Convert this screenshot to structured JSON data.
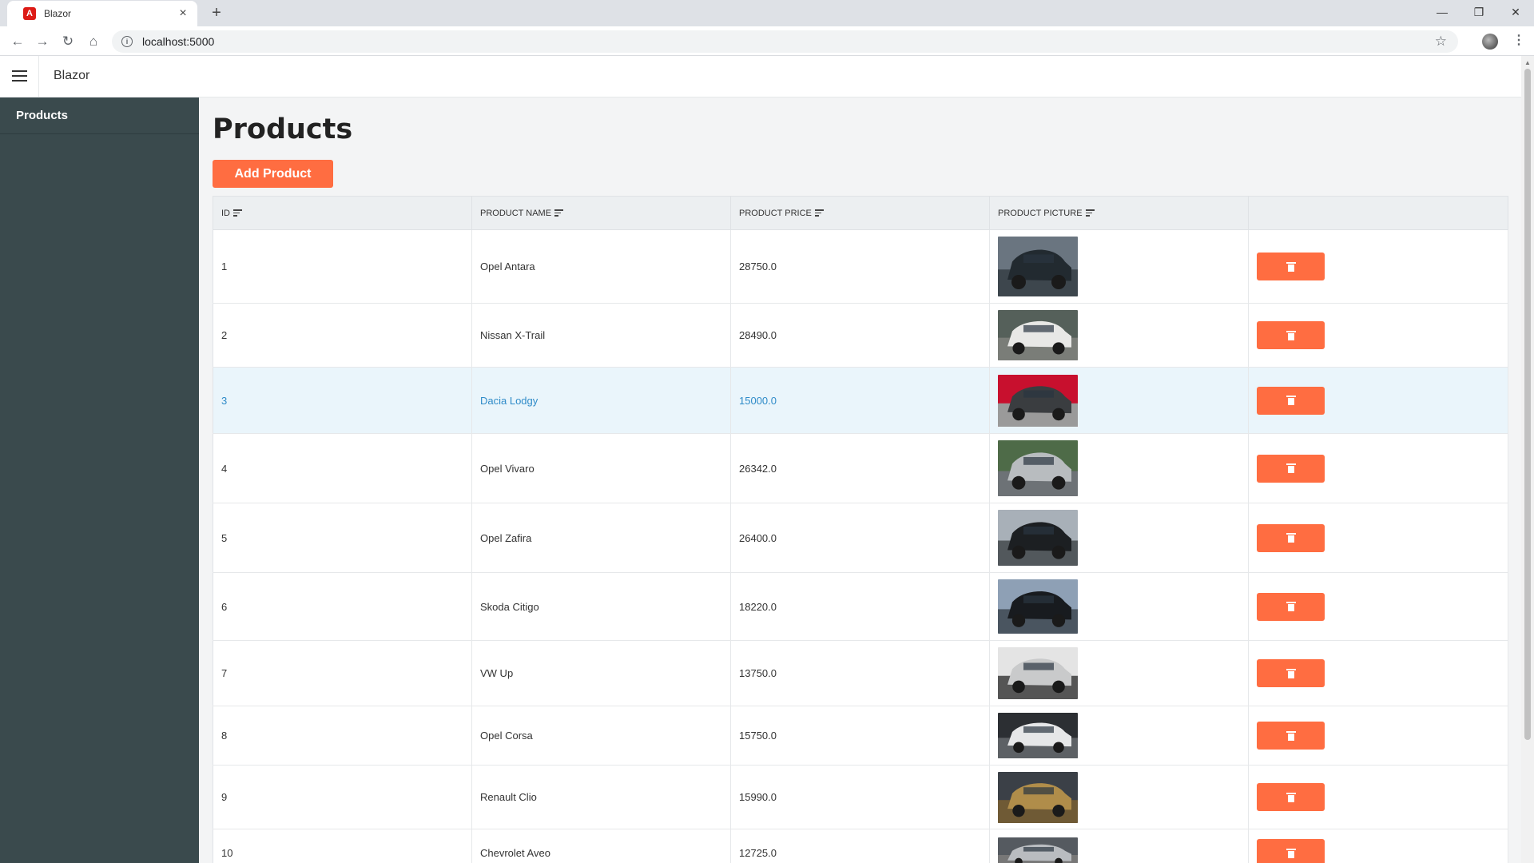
{
  "browser": {
    "tab_title": "Blazor",
    "tab_favicon": "A",
    "new_tab": "+",
    "url": "localhost:5000"
  },
  "app": {
    "title": "Blazor",
    "sidebar": {
      "items": [
        {
          "label": "Products"
        }
      ]
    }
  },
  "page": {
    "title": "Products",
    "add_label": "Add Product"
  },
  "grid": {
    "columns": [
      "ID",
      "PRODUCT NAME",
      "PRODUCT PRICE",
      "PRODUCT PICTURE"
    ],
    "rows": [
      {
        "id": "1",
        "name": "Opel Antara",
        "price": "28750.0",
        "img": "dark-suv",
        "selected": false
      },
      {
        "id": "2",
        "name": "Nissan X-Trail",
        "price": "28490.0",
        "img": "white-suv",
        "selected": false
      },
      {
        "id": "3",
        "name": "Dacia Lodgy",
        "price": "15000.0",
        "img": "dark-mpv",
        "selected": true
      },
      {
        "id": "4",
        "name": "Opel Vivaro",
        "price": "26342.0",
        "img": "silver-van",
        "selected": false
      },
      {
        "id": "5",
        "name": "Opel Zafira",
        "price": "26400.0",
        "img": "black-mpv",
        "selected": false
      },
      {
        "id": "6",
        "name": "Skoda Citigo",
        "price": "18220.0",
        "img": "black-small",
        "selected": false
      },
      {
        "id": "7",
        "name": "VW Up",
        "price": "13750.0",
        "img": "silver-small",
        "selected": false
      },
      {
        "id": "8",
        "name": "Opel Corsa",
        "price": "15750.0",
        "img": "white-hatch",
        "selected": false
      },
      {
        "id": "9",
        "name": "Renault Clio",
        "price": "15990.0",
        "img": "gold-hatch",
        "selected": false
      },
      {
        "id": "10",
        "name": "Chevrolet Aveo",
        "price": "12725.0",
        "img": "silver-sedan",
        "selected": false
      }
    ]
  },
  "colors": {
    "accent": "#ff6d41",
    "sidebar": "#3a4a4d",
    "selected_text": "#2f8bc8",
    "selected_bg": "#eaf5fb"
  },
  "icons": {
    "sort": "sort-icon",
    "delete": "trash-icon",
    "menu": "hamburger-icon"
  }
}
